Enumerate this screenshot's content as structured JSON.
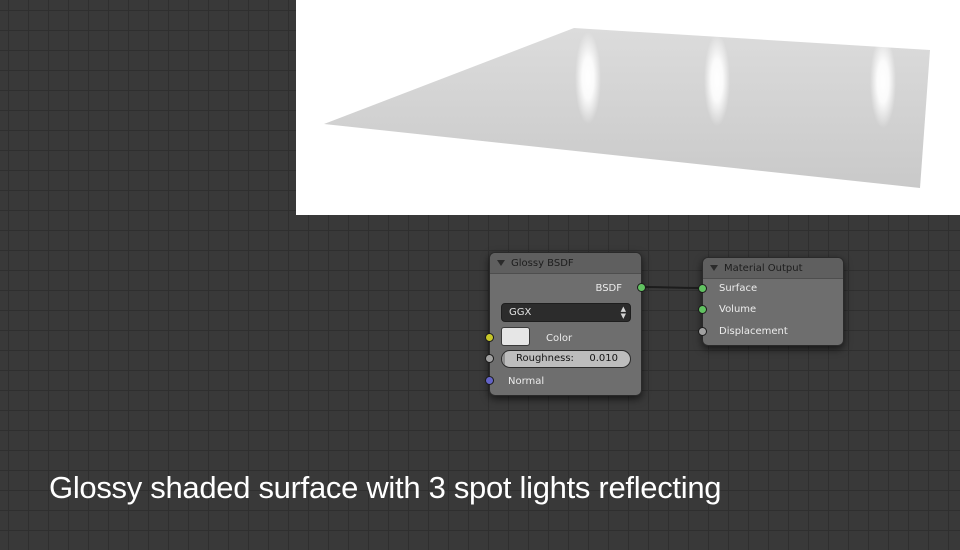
{
  "nodes": {
    "glossy_bsdf": {
      "title": "Glossy BSDF",
      "output_label": "BSDF",
      "distribution": "GGX",
      "color_label": "Color",
      "color_value": "#e6e6e6",
      "roughness_label": "Roughness:",
      "roughness_value": "0.010",
      "roughness_fraction": 0.01,
      "normal_label": "Normal"
    },
    "material_output": {
      "title": "Material Output",
      "surface_label": "Surface",
      "volume_label": "Volume",
      "displacement_label": "Displacement"
    }
  },
  "caption": "Glossy shaded surface with 3 spot lights reflecting",
  "colors": {
    "editor_background": "#393939",
    "grid_line": "#2f2f2f",
    "socket_shader": "#61c261",
    "socket_color": "#c7c729",
    "socket_value": "#a1a1a1",
    "socket_vector": "#6363c7"
  },
  "icons": {
    "collapse": "triangle-down-icon",
    "dropdown": "updown-arrows-icon"
  }
}
